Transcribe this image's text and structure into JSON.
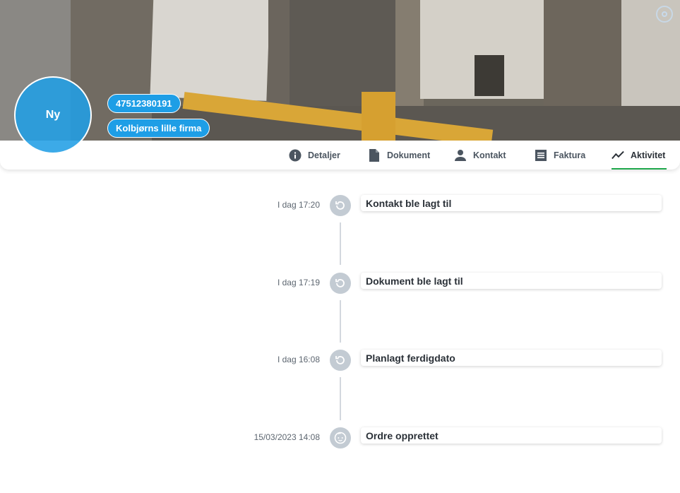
{
  "header": {
    "avatar_text": "Ny",
    "phone": "47512380191",
    "company": "Kolbjørns lille firma"
  },
  "tabs": [
    {
      "label": "Detaljer",
      "icon": "info-icon"
    },
    {
      "label": "Dokument",
      "icon": "document-icon"
    },
    {
      "label": "Kontakt",
      "icon": "person-icon"
    },
    {
      "label": "Faktura",
      "icon": "invoice-icon"
    },
    {
      "label": "Aktivitet",
      "icon": "activity-icon",
      "active": true
    }
  ],
  "timeline": [
    {
      "time": "I dag 17:20",
      "title": "Kontakt ble lagt til",
      "icon": "history-icon"
    },
    {
      "time": "I dag 17:19",
      "title": "Dokument ble lagt til",
      "icon": "history-icon"
    },
    {
      "time": "I dag 16:08",
      "title": "Planlagt ferdigdato",
      "icon": "history-icon"
    },
    {
      "time": "15/03/2023 14:08",
      "title": "Ordre opprettet",
      "icon": "baby-face-icon"
    }
  ],
  "colors": {
    "accent": "#1e9ee6",
    "active_tab_underline": "#1fa84c",
    "timeline_dot": "#c3cbd3"
  }
}
